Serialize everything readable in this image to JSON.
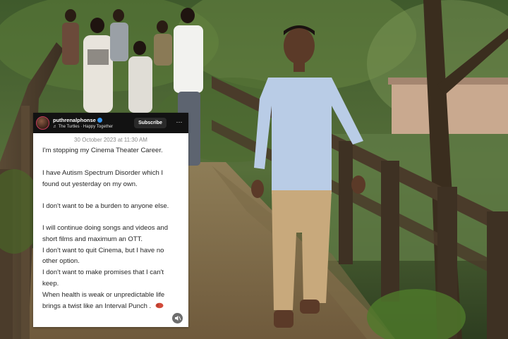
{
  "post": {
    "username": "puthrenalphonse",
    "music": "The Turtles · Happy Together",
    "subscribe_label": "Subscribe",
    "more_label": "···",
    "timestamp": "30 October 2023 at 11:30 AM",
    "lines": [
      "I'm stopping my Cinema Theater Career.",
      "I have Autism Spectrum Disorder which I",
      "found out yesterday on my own.",
      "I don't want to be a burden to anyone else.",
      "I will continue doing songs and videos and",
      "short films and maximum an OTT.",
      "I don't want to quit Cinema, but I have no",
      "other option.",
      "I don't want to make promises that I can't",
      "keep.",
      "When health is weak or unpredictable life",
      "brings a twist like an Interval Punch ."
    ],
    "icons": [
      "verified-badge-icon",
      "music-note-icon",
      "more-options-icon",
      "fist-bump-emoji-icon",
      "mute-icon",
      "avatar"
    ]
  },
  "colors": {
    "card_background": "#ffffff",
    "header_background": "#121212",
    "verified_blue": "#3897f0",
    "text": "#262626",
    "timestamp": "#8a8a8a"
  }
}
